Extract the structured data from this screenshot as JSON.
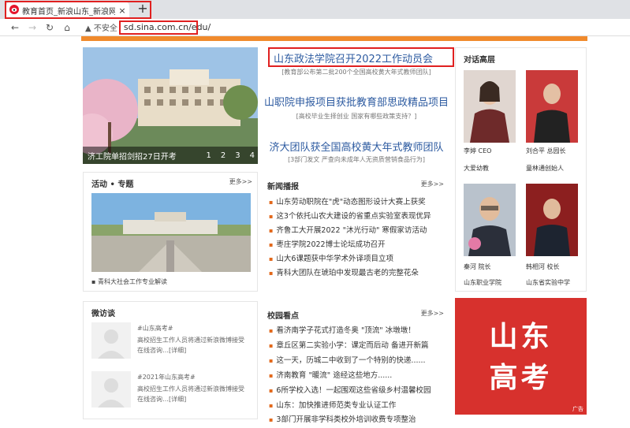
{
  "browser": {
    "tab_title": "教育首页_新浪山东_新浪网_山东",
    "new_tab": "+",
    "close": "×",
    "insecure_label": "不安全",
    "url": "sd.sina.com.cn/edu/"
  },
  "slider": {
    "caption": "济工院单招剑招27日开考",
    "pages": [
      "1",
      "2",
      "3",
      "4"
    ]
  },
  "headlines": [
    {
      "title": "山东政法学院召开2022工作动员会",
      "sub": "[教育部公布第二批200个全国高校黄大年式教师团队]"
    },
    {
      "title": "山职院申报项目获批教育部思政精品项目",
      "sub": "[高校毕业生择创业 国家有哪些政策支持？]"
    },
    {
      "title": "济大团队获全国高校黄大年式教师团队",
      "sub": "[3部门发文 严查向未成年人无资质营销食品行为]"
    }
  ],
  "activity": {
    "title": "活动 • 专题",
    "more": "更多>>",
    "caption": "▪ 青科大社会工作专业解读"
  },
  "news": {
    "title": "新闻播报",
    "more": "更多>>",
    "items": [
      "山东劳动职院在\"虎\"动态图形设计大赛上获奖",
      "这3个依托山农大建设的省重点实验室表现优异",
      "齐鲁工大开展2022 \"沐光行动\" 寒假家访活动",
      "枣庄学院2022博士论坛成功召开",
      "山大6课题获中华学术外译项目立项",
      "青科大团队在琥珀中发现最古老的完整花朵"
    ]
  },
  "dialogue": {
    "title": "对话高层",
    "people": [
      {
        "name": "李婷  CEO",
        "org": "大爱幼教"
      },
      {
        "name": "刘合平  总园长",
        "org": "童林通创始人"
      },
      {
        "name": "秦河  院长",
        "org": "山东职业学院"
      },
      {
        "name": "韩相河  校长",
        "org": "山东省实验中学"
      }
    ]
  },
  "interview": {
    "title": "微访谈",
    "items": [
      {
        "tag": "#山东高考#",
        "text": "高校招生工作人员将通过新浪微博接受在线咨询…[详细]"
      },
      {
        "tag": "#2021年山东高考#",
        "text": "高校招生工作人员将通过新浪微博接受在线咨询…[详细]"
      }
    ]
  },
  "campus": {
    "title": "校园看点",
    "more": "更多>>",
    "items": [
      "看济南学子花式打造冬奥 \"顶流\" 冰墩墩！",
      "章丘区第二实验小学：课定而后动 备进开新篇",
      "这一天，历城二中收到了一个特别的快递......",
      "济南教育 \"暖流\" 途经这些地方......",
      "6所学校入选！一起围观这些省级乡村温馨校园",
      "山东：加快推进师范类专业认证工作",
      "3部门开展非学科类校外培训收费专项整治"
    ]
  },
  "ad": {
    "line1": "山东",
    "line2": "高考",
    "label": "广告"
  }
}
